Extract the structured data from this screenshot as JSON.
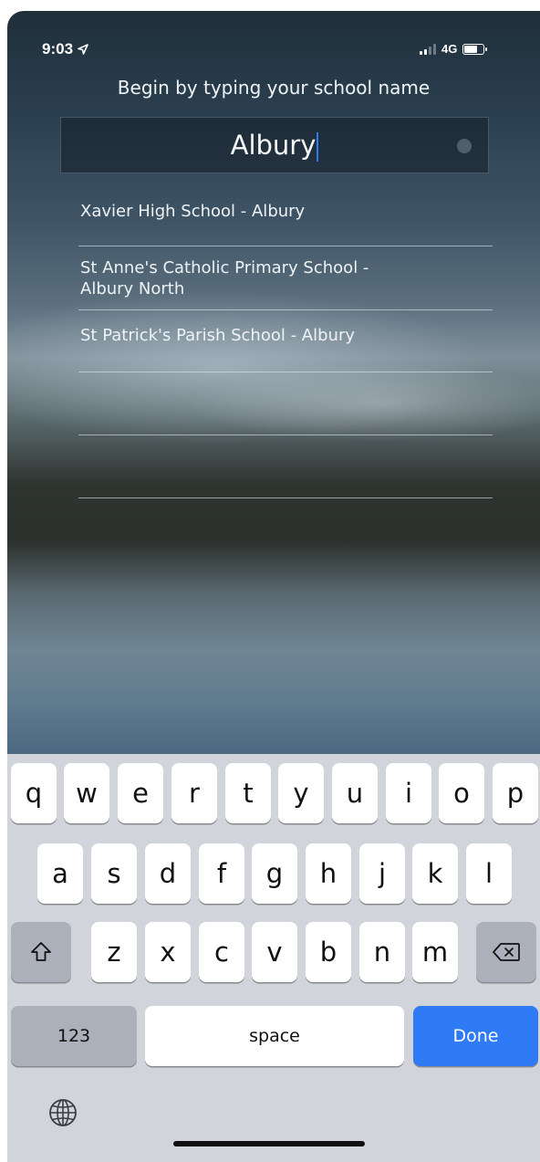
{
  "status_bar": {
    "time": "9:03",
    "network": "4G"
  },
  "prompt": "Begin by typing your school name",
  "search": {
    "value": "Albury"
  },
  "results": [
    {
      "label": "Xavier High School - Albury"
    },
    {
      "label_line1": "St Anne's Catholic Primary School -",
      "label_line2": "Albury North"
    },
    {
      "label": "St Patrick's Parish School - Albury"
    }
  ],
  "keyboard": {
    "row1": [
      "q",
      "w",
      "e",
      "r",
      "t",
      "y",
      "u",
      "i",
      "o",
      "p"
    ],
    "row2": [
      "a",
      "s",
      "d",
      "f",
      "g",
      "h",
      "j",
      "k",
      "l"
    ],
    "row3": [
      "z",
      "x",
      "c",
      "v",
      "b",
      "n",
      "m"
    ],
    "numbers_label": "123",
    "space_label": "space",
    "done_label": "Done"
  },
  "colors": {
    "accent": "#2f7bf5",
    "keyboard_bg": "#d1d4db"
  }
}
